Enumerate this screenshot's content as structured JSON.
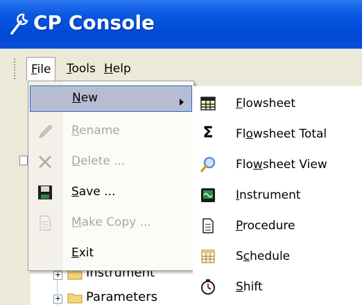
{
  "window": {
    "title": "CP Console",
    "title_icon": "wrench-icon"
  },
  "menubar": {
    "items": [
      {
        "label_u": "F",
        "label_rest": "ile"
      },
      {
        "label_u": "T",
        "label_rest": "ools"
      },
      {
        "label_u": "H",
        "label_rest": "elp"
      }
    ]
  },
  "file_menu": {
    "items": [
      {
        "label_u": "N",
        "label_rest": "ew",
        "enabled": true,
        "highlighted": true,
        "has_submenu": true,
        "icon": ""
      },
      {
        "label_u": "R",
        "label_rest": "ename",
        "enabled": false,
        "icon": "pencil-icon"
      },
      {
        "label_u": "D",
        "label_rest": "elete ...",
        "enabled": false,
        "icon": "delete-x-icon"
      },
      {
        "label_u": "S",
        "label_rest": "ave ...",
        "enabled": true,
        "icon": "floppy-disk-icon"
      },
      {
        "label_u": "M",
        "label_rest": "ake Copy ...",
        "enabled": false,
        "icon": "copy-page-icon"
      },
      {
        "label_u": "E",
        "label_rest": "xit",
        "enabled": true,
        "icon": ""
      }
    ]
  },
  "new_submenu": {
    "items": [
      {
        "label_pre": "",
        "label_u": "F",
        "label_rest": "lowsheet",
        "icon": "grid-table-icon"
      },
      {
        "label_pre": "Fl",
        "label_u": "o",
        "label_rest": "wsheet Total",
        "icon": "sigma-icon"
      },
      {
        "label_pre": "Flo",
        "label_u": "w",
        "label_rest": "sheet View",
        "icon": "magnifier-icon"
      },
      {
        "label_pre": "",
        "label_u": "I",
        "label_rest": "nstrument",
        "icon": "instrument-monitor-icon"
      },
      {
        "label_pre": "",
        "label_u": "P",
        "label_rest": "rocedure",
        "icon": "document-icon"
      },
      {
        "label_pre": "S",
        "label_u": "c",
        "label_rest": "hedule",
        "icon": "schedule-calendar-icon"
      },
      {
        "label_pre": "",
        "label_u": "S",
        "label_rest": "hift",
        "icon": "shift-clock-icon"
      }
    ]
  },
  "tree": {
    "items": [
      {
        "label": "Instrument",
        "icon": "folder-icon"
      },
      {
        "label": "Parameters",
        "icon": "folder-icon"
      }
    ]
  },
  "colors": {
    "titlebar": "#0a58e0",
    "menubar": "#ece9d8",
    "highlight": "#b6bdd2",
    "disabled_text": "#a8a89a"
  }
}
